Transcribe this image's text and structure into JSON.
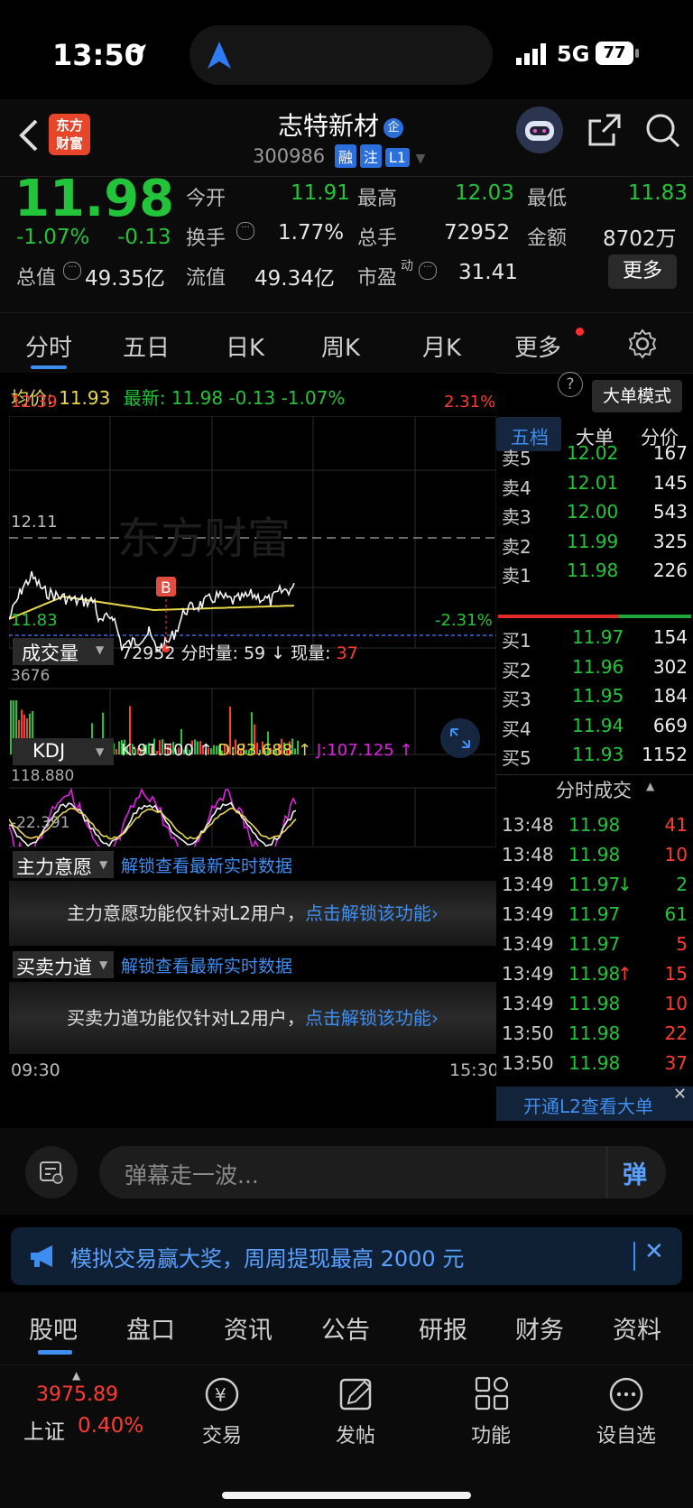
{
  "status_bar": {
    "time": "13:50",
    "network": "5G",
    "battery": "77"
  },
  "header": {
    "logo_line1": "东方",
    "logo_line2": "财富",
    "stock_name": "志特新材",
    "name_badge": "企",
    "stock_code": "300986",
    "badges": [
      "融",
      "注",
      "L1"
    ]
  },
  "quote": {
    "price": "11.98",
    "change_pct": "-1.07%",
    "change": "-0.13",
    "stats": [
      {
        "label": "今开",
        "value": "11.91"
      },
      {
        "label": "最高",
        "value": "12.03"
      },
      {
        "label": "最低",
        "value": "11.83"
      },
      {
        "label": "换手",
        "value": "1.77%"
      },
      {
        "label": "总手",
        "value": "72952"
      },
      {
        "label": "金额",
        "value": "8702万"
      },
      {
        "label": "总值",
        "value": "49.35亿"
      },
      {
        "label": "流值",
        "value": "49.34亿"
      },
      {
        "label": "市盈",
        "value": "31.41"
      }
    ],
    "pe_sup": "动",
    "more_button": "更多"
  },
  "tabs": [
    "分时",
    "五日",
    "日K",
    "周K",
    "月K",
    "更多"
  ],
  "chart_header": {
    "avg_label": "均价:",
    "avg_value": "11.93",
    "latest_label": "最新:",
    "latest_value": "11.98",
    "latest_change": "-0.13",
    "latest_pct": "-1.07%",
    "big_order_mode": "大单模式"
  },
  "price_chart": {
    "high_price": "12.39",
    "high_pct": "2.31%",
    "mid_price": "12.11",
    "low_price": "11.83",
    "low_pct": "-2.31%",
    "marker": "B",
    "watermark": "东方财富"
  },
  "volume_panel": {
    "label": "成交量",
    "total": "72952",
    "min_label": "分时量:",
    "min_value": "59",
    "cur_label": "现量:",
    "cur_value": "37",
    "max": "3676"
  },
  "kdj_panel": {
    "label": "KDJ",
    "k": "K:91.500",
    "d": "D:83.688",
    "j": "J:107.125",
    "top": "118.880",
    "bottom": "-22.391"
  },
  "main_force": {
    "label": "主力意愿",
    "unlock_link": "解锁查看最新实时数据",
    "notice": "主力意愿功能仅针对L2用户，",
    "notice_link": "点击解锁该功能"
  },
  "buy_sell": {
    "label": "买卖力道",
    "unlock_link": "解锁查看最新实时数据",
    "notice": "买卖力道功能仅针对L2用户，",
    "notice_link": "点击解锁该功能"
  },
  "time_axis": {
    "start": "09:30",
    "end": "15:30"
  },
  "order_book": {
    "tabs": [
      "五档",
      "大单",
      "分价"
    ],
    "asks": [
      {
        "label": "卖5",
        "price": "12.02",
        "vol": "167"
      },
      {
        "label": "卖4",
        "price": "12.01",
        "vol": "145"
      },
      {
        "label": "卖3",
        "price": "12.00",
        "vol": "543"
      },
      {
        "label": "卖2",
        "price": "11.99",
        "vol": "325"
      },
      {
        "label": "卖1",
        "price": "11.98",
        "vol": "226"
      }
    ],
    "bids": [
      {
        "label": "买1",
        "price": "11.97",
        "vol": "154"
      },
      {
        "label": "买2",
        "price": "11.96",
        "vol": "302"
      },
      {
        "label": "买3",
        "price": "11.95",
        "vol": "184"
      },
      {
        "label": "买4",
        "price": "11.94",
        "vol": "669"
      },
      {
        "label": "买5",
        "price": "11.93",
        "vol": "1152"
      }
    ],
    "ticks_title": "分时成交",
    "ticks": [
      {
        "time": "13:48",
        "price": "11.98",
        "vol": "41",
        "dir": "",
        "color": "red"
      },
      {
        "time": "13:48",
        "price": "11.98",
        "vol": "10",
        "dir": "",
        "color": "red"
      },
      {
        "time": "13:49",
        "price": "11.97",
        "vol": "2",
        "dir": "↓",
        "color": "green"
      },
      {
        "time": "13:49",
        "price": "11.97",
        "vol": "61",
        "dir": "",
        "color": "green"
      },
      {
        "time": "13:49",
        "price": "11.97",
        "vol": "5",
        "dir": "",
        "color": "red"
      },
      {
        "time": "13:49",
        "price": "11.98",
        "vol": "15",
        "dir": "↑",
        "color": "red"
      },
      {
        "time": "13:49",
        "price": "11.98",
        "vol": "10",
        "dir": "",
        "color": "red"
      },
      {
        "time": "13:50",
        "price": "11.98",
        "vol": "22",
        "dir": "",
        "color": "red"
      },
      {
        "time": "13:50",
        "price": "11.98",
        "vol": "37",
        "dir": "",
        "color": "red"
      }
    ],
    "l2_banner": "开通L2查看大单"
  },
  "danmu": {
    "placeholder": "弹幕走一波...",
    "button": "弹"
  },
  "promo": {
    "text": "模拟交易赢大奖，周周提现最高 2000 元"
  },
  "bottom_tabs": [
    "股吧",
    "盘口",
    "资讯",
    "公告",
    "研报",
    "财务",
    "资料"
  ],
  "dock": {
    "index_value": "3975.89",
    "index_name": "上证",
    "index_pct": "0.40%",
    "items": [
      "交易",
      "发帖",
      "功能",
      "设自选"
    ]
  },
  "colors": {
    "up": "#ff3b30",
    "down": "#22c43a",
    "accent": "#3d8ef0",
    "avg_line": "#e8d84a"
  }
}
